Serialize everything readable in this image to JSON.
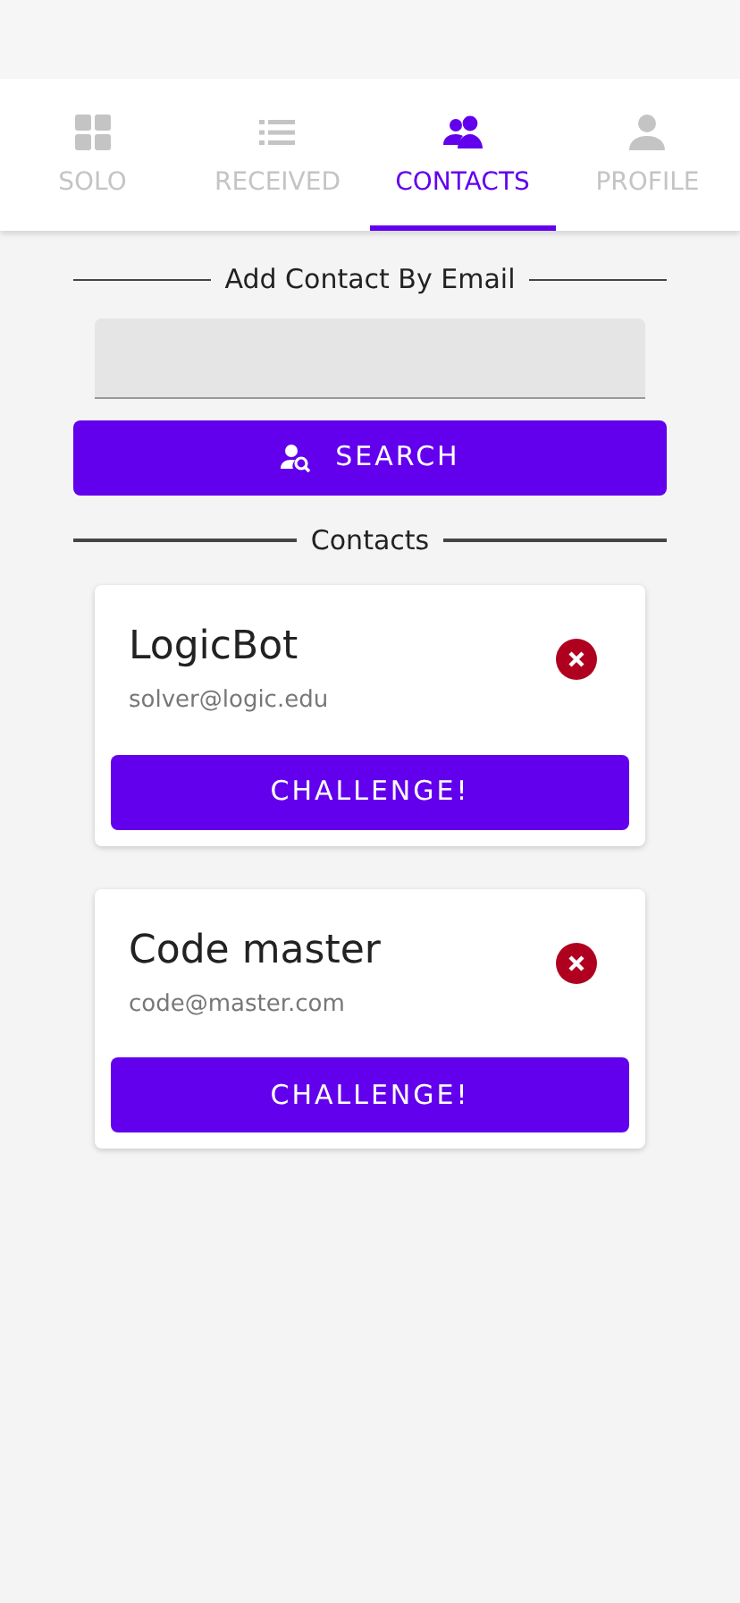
{
  "tabs": [
    {
      "label": "SOLO",
      "kind": "grid",
      "selected": false
    },
    {
      "label": "RECEIVED",
      "kind": "list",
      "selected": false
    },
    {
      "label": "CONTACTS",
      "kind": "people",
      "selected": true
    },
    {
      "label": "PROFILE",
      "kind": "person",
      "selected": false
    }
  ],
  "add_section": {
    "heading": "Add Contact By Email",
    "search_button": "SEARCH"
  },
  "contacts_section": {
    "heading": "Contacts"
  },
  "contacts": [
    {
      "name": "LogicBot",
      "email": "solver@logic.edu",
      "button": "CHALLENGE!"
    },
    {
      "name": "Code master",
      "email": "code@master.com",
      "button": "CHALLENGE!"
    }
  ]
}
